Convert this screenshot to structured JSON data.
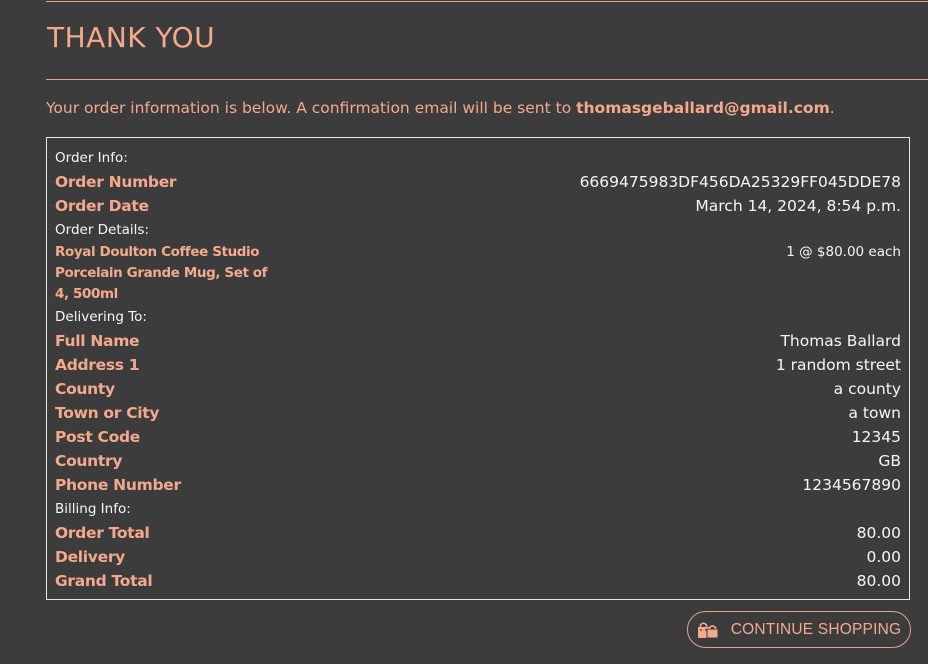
{
  "page": {
    "title": "THANK YOU",
    "intro_text": "Your order information is below. A confirmation email will be sent to ",
    "email": "thomasgeballard@gmail.com",
    "intro_end": "."
  },
  "order_info": {
    "heading": "Order Info:",
    "order_number_label": "Order Number",
    "order_number": "6669475983DF456DA25329FF045DDE78",
    "order_date_label": "Order Date",
    "order_date": "March 14, 2024, 8:54 p.m."
  },
  "order_details": {
    "heading": "Order Details:",
    "product_name": "Royal Doulton Coffee Studio Porcelain Grande Mug, Set of 4, 500ml",
    "quantity_text": "1 @ $80.00 each"
  },
  "delivery": {
    "heading": "Delivering To:",
    "rows": [
      {
        "label": "Full Name",
        "value": "Thomas Ballard"
      },
      {
        "label": "Address 1",
        "value": "1 random street"
      },
      {
        "label": "County",
        "value": "a county"
      },
      {
        "label": "Town or City",
        "value": "a town"
      },
      {
        "label": "Post Code",
        "value": "12345"
      },
      {
        "label": "Country",
        "value": "GB"
      },
      {
        "label": "Phone Number",
        "value": "1234567890"
      }
    ]
  },
  "billing": {
    "heading": "Billing Info:",
    "rows": [
      {
        "label": "Order Total",
        "value": "80.00"
      },
      {
        "label": "Delivery",
        "value": "0.00"
      },
      {
        "label": "Grand Total",
        "value": "80.00"
      }
    ]
  },
  "actions": {
    "continue_label": "CONTINUE SHOPPING",
    "continue_icon": "shopping-bags-icon"
  },
  "colors": {
    "background": "#3c3c3c",
    "accent": "#f4a98c",
    "text": "#f5f5f5"
  }
}
